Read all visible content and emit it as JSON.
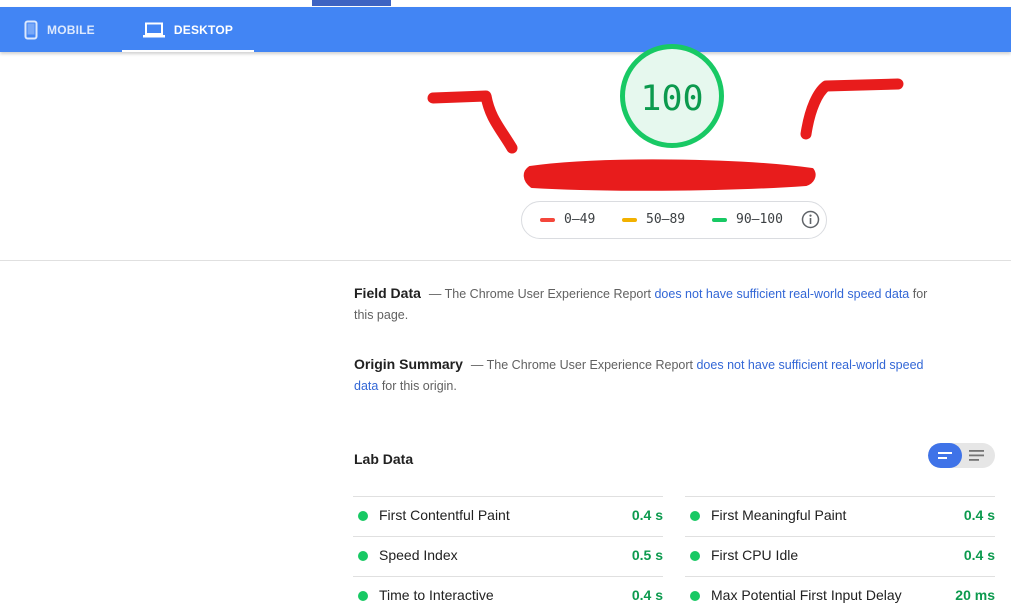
{
  "tabs": [
    {
      "label": "MOBILE",
      "icon": "smartphone-icon",
      "active": false
    },
    {
      "label": "DESKTOP",
      "icon": "laptop-icon",
      "active": true
    }
  ],
  "score": {
    "value": "100",
    "color": "#18c964"
  },
  "legend": [
    {
      "label": "0–49",
      "color": "#f4473b"
    },
    {
      "label": "50–89",
      "color": "#f2b100"
    },
    {
      "label": "90–100",
      "color": "#18c964"
    }
  ],
  "field_data": {
    "title": "Field Data",
    "text_before": "— The Chrome User Experience Report ",
    "link": "does not have sufficient real-world speed data",
    "text_after": " for this page."
  },
  "origin_summary": {
    "title": "Origin Summary",
    "text_before": "— The Chrome User Experience Report ",
    "link": "does not have sufficient real-world speed data",
    "text_after": " for this origin."
  },
  "lab_data": {
    "title": "Lab Data",
    "metrics_left": [
      {
        "name": "First Contentful Paint",
        "value": "0.4 s"
      },
      {
        "name": "Speed Index",
        "value": "0.5 s"
      },
      {
        "name": "Time to Interactive",
        "value": "0.4 s"
      }
    ],
    "metrics_right": [
      {
        "name": "First Meaningful Paint",
        "value": "0.4 s"
      },
      {
        "name": "First CPU Idle",
        "value": "0.4 s"
      },
      {
        "name": "Max Potential First Input Delay",
        "value": "20 ms"
      }
    ]
  }
}
